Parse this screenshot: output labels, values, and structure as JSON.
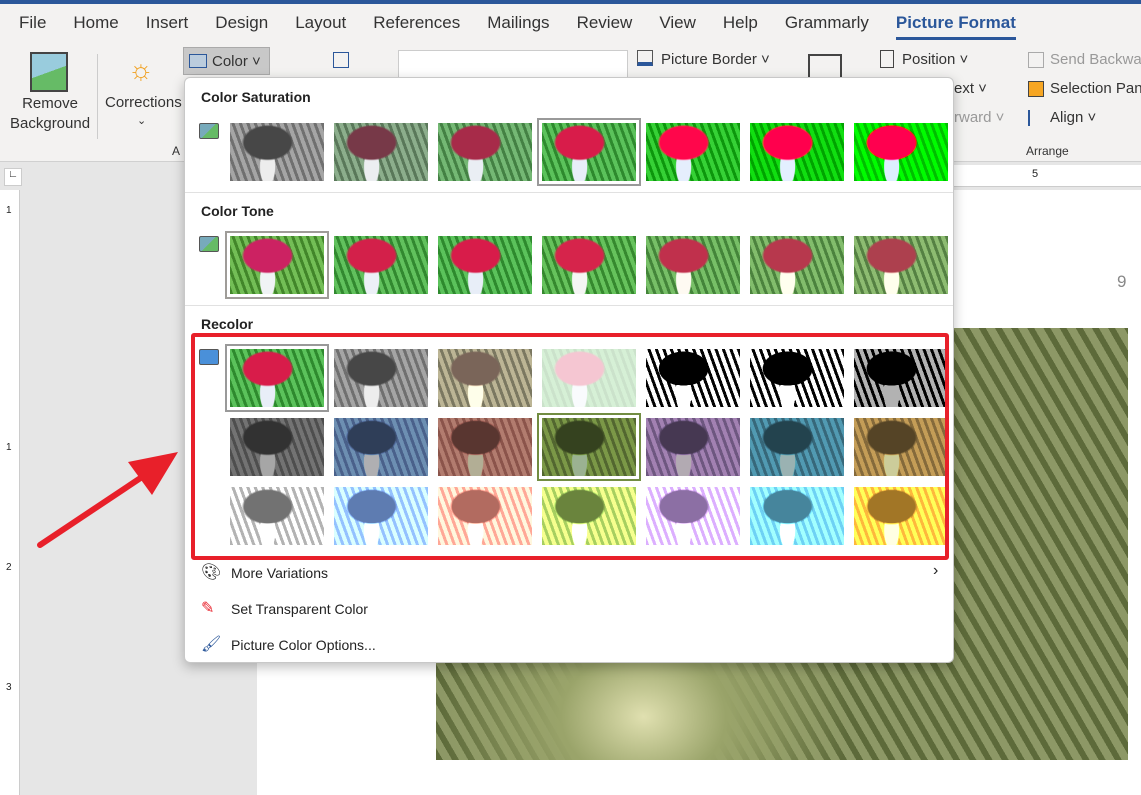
{
  "tabs": [
    "File",
    "Home",
    "Insert",
    "Design",
    "Layout",
    "References",
    "Mailings",
    "Review",
    "View",
    "Help",
    "Grammarly",
    "Picture Format"
  ],
  "active_tab": "Picture Format",
  "ribbon": {
    "remove_bg_1": "Remove",
    "remove_bg_2": "Background",
    "corrections": "Corrections",
    "color": "Color",
    "picture_border": "Picture Border",
    "position": "Position",
    "wrap_text": "ext",
    "bring_forward": "rward",
    "send_backward": "Send Backwa",
    "selection_pane": "Selection Pan",
    "align": "Align",
    "adjust_group": "A",
    "arrange_group": "Arrange"
  },
  "ruler": {
    "h_mark": "5",
    "v_marks": [
      "1",
      "1",
      "2",
      "3"
    ]
  },
  "page_number": "9",
  "gallery": {
    "saturation_title": "Color Saturation",
    "tone_title": "Color Tone",
    "recolor_title": "Recolor",
    "saturation": [
      "saturate(0)",
      "saturate(0.33)",
      "saturate(0.66)",
      "saturate(1)",
      "saturate(1.5)",
      "saturate(2)",
      "saturate(3)"
    ],
    "saturation_selected": 3,
    "tone": [
      "sepia(0.1) hue-rotate(-10deg)",
      "sepia(0.05)",
      "none",
      "sepia(0.15) saturate(1.1)",
      "sepia(0.25)",
      "sepia(0.35)",
      "sepia(0.45)"
    ],
    "tone_selected": 0,
    "recolor": [
      [
        "none",
        "grayscale(1)",
        "sepia(0.9) grayscale(0.3)",
        "opacity(0.25)",
        "grayscale(1) contrast(8) brightness(1.8)",
        "grayscale(1) contrast(8) brightness(1.2)",
        "grayscale(1) contrast(8) brightness(0.7)"
      ],
      [
        "grayscale(1) brightness(0.7)",
        "grayscale(1) sepia(1) hue-rotate(180deg) saturate(2) brightness(0.7)",
        "grayscale(1) sepia(1) hue-rotate(-40deg) saturate(2) brightness(0.7)",
        "grayscale(1) sepia(1) hue-rotate(40deg) saturate(2) brightness(0.7)",
        "grayscale(1) sepia(1) hue-rotate(230deg) saturate(1.5) brightness(0.7)",
        "grayscale(1) sepia(1) hue-rotate(150deg) saturate(2) brightness(0.7)",
        "grayscale(1) sepia(1) saturate(2) brightness(0.8)"
      ],
      [
        "grayscale(1) brightness(1.6)",
        "grayscale(1) sepia(1) hue-rotate(180deg) saturate(2) brightness(1.4)",
        "grayscale(1) sepia(1) hue-rotate(-40deg) saturate(2) brightness(1.4)",
        "grayscale(1) sepia(1) hue-rotate(40deg) saturate(2) brightness(1.4)",
        "grayscale(1) sepia(1) hue-rotate(230deg) saturate(1.5) brightness(1.4)",
        "grayscale(1) sepia(1) hue-rotate(150deg) saturate(2) brightness(1.4)",
        "grayscale(1) sepia(1) saturate(3) brightness(1.4)"
      ]
    ],
    "recolor_selected": [
      [
        0,
        0
      ],
      [
        1,
        3
      ]
    ],
    "more_variations": "More Variations",
    "set_transparent": "Set Transparent Color",
    "picture_color_options": "Picture Color Options..."
  },
  "highlight_color": "#e8202a",
  "accent_color": "#2b579a"
}
